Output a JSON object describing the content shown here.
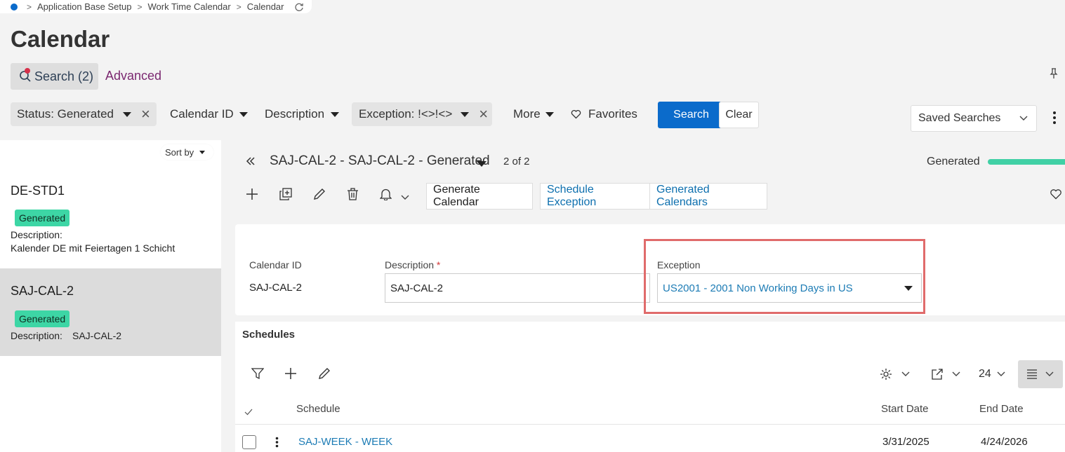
{
  "breadcrumb": {
    "items": [
      "Application Base Setup",
      "Work Time Calendar",
      "Calendar"
    ]
  },
  "page": {
    "title": "Calendar"
  },
  "search_tabs": {
    "search": "Search (2)",
    "advanced": "Advanced"
  },
  "filters": {
    "status": "Status: Generated",
    "calendar_id": "Calendar ID",
    "description": "Description",
    "exception": "Exception: !<>!<>",
    "more": "More",
    "favorites": "Favorites",
    "search_button": "Search",
    "clear_button": "Clear",
    "saved_searches": "Saved Searches"
  },
  "list": {
    "sort_by": "Sort by",
    "items": [
      {
        "title": "DE-STD1",
        "badge": "Generated",
        "desc_label": "Description:",
        "desc_value": "Kalender DE mit Feiertagen 1 Schicht"
      },
      {
        "title": "SAJ-CAL-2",
        "badge": "Generated",
        "desc_label": "Description:",
        "desc_value": "SAJ-CAL-2"
      }
    ]
  },
  "record": {
    "title": "SAJ-CAL-2 - SAJ-CAL-2 - Generated",
    "count": "2 of 2",
    "status": "Generated",
    "progress_fraction": 1.0
  },
  "toolbar": {
    "generate_calendar": "Generate Calendar",
    "schedule_exception": "Schedule Exception",
    "generated_calendars": "Generated Calendars"
  },
  "form": {
    "calendar_id_label": "Calendar ID",
    "calendar_id_value": "SAJ-CAL-2",
    "description_label": "Description",
    "required_mark": "*",
    "description_value": "SAJ-CAL-2",
    "exception_label": "Exception",
    "exception_value": "US2001 - 2001 Non Working Days in US"
  },
  "schedules": {
    "title": "Schedules",
    "page_size": "24",
    "columns": {
      "schedule": "Schedule",
      "start_date": "Start Date",
      "end_date": "End Date"
    },
    "rows": [
      {
        "schedule": "SAJ-WEEK - WEEK",
        "start_date": "3/31/2025",
        "end_date": "4/24/2026"
      }
    ]
  },
  "colors": {
    "primary": "#0b6bcb",
    "generated_badge": "#3dd6a5",
    "highlight": "#e06b6b",
    "link": "#1d7cb5"
  }
}
